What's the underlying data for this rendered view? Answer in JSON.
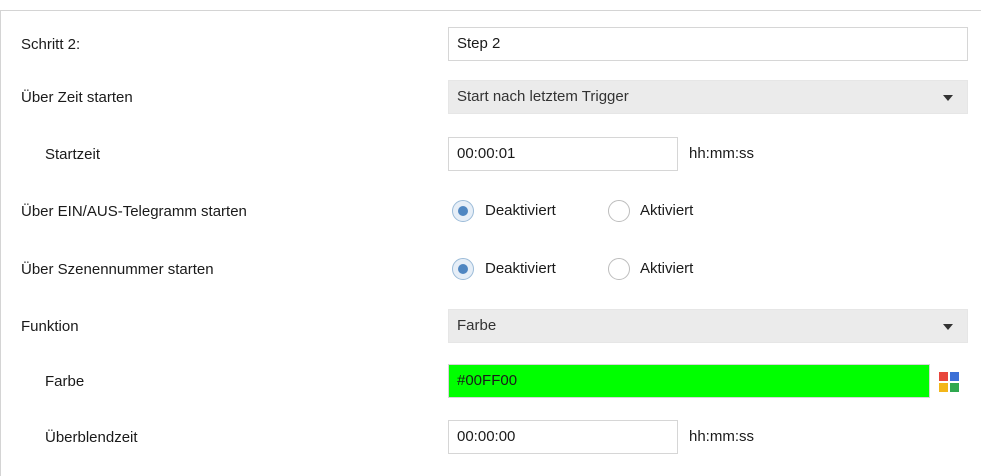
{
  "rows": {
    "schritt": {
      "label": "Schritt 2:",
      "value": "Step 2"
    },
    "zeit_starten": {
      "label": "Über Zeit starten",
      "value": "Start nach letztem Trigger"
    },
    "startzeit": {
      "label": "Startzeit",
      "value": "00:00:01",
      "unit": "hh:mm:ss"
    },
    "ein_aus": {
      "label": "Über EIN/AUS-Telegramm starten",
      "option_off": "Deaktiviert",
      "option_on": "Aktiviert",
      "selected": "Deaktiviert"
    },
    "szenennummer": {
      "label": "Über Szenennummer starten",
      "option_off": "Deaktiviert",
      "option_on": "Aktiviert",
      "selected": "Deaktiviert"
    },
    "funktion": {
      "label": "Funktion",
      "value": "Farbe"
    },
    "farbe": {
      "label": "Farbe",
      "value": "#00FF00",
      "color": "#00FF00"
    },
    "ueberblendzeit": {
      "label": "Überblendzeit",
      "value": "00:00:00",
      "unit": "hh:mm:ss"
    }
  },
  "palette_icon": {
    "name": "color-palette-icon",
    "colors": [
      "#e8463c",
      "#3b6fd6",
      "#f3b61a",
      "#2fa84f"
    ]
  },
  "radio_accent": "#4f86c1"
}
